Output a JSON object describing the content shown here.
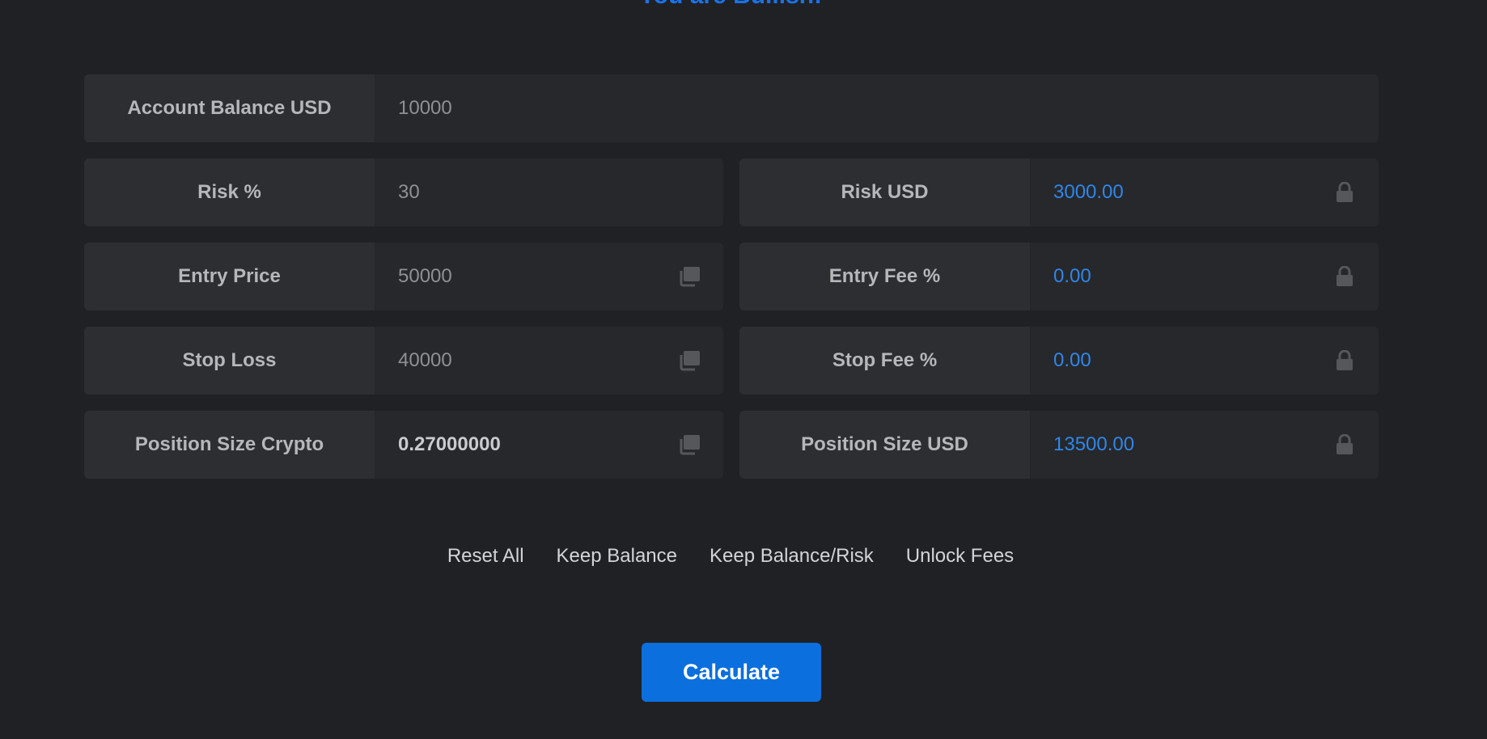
{
  "header": {
    "title": "You are Bullish!"
  },
  "fields": {
    "account_balance": {
      "label": "Account Balance USD",
      "value": "10000"
    },
    "risk_pct": {
      "label": "Risk %",
      "value": "30"
    },
    "risk_usd": {
      "label": "Risk USD",
      "value": "3000.00"
    },
    "entry_price": {
      "label": "Entry Price",
      "value": "50000"
    },
    "entry_fee": {
      "label": "Entry Fee %",
      "value": "0.00"
    },
    "stop_loss": {
      "label": "Stop Loss",
      "value": "40000"
    },
    "stop_fee": {
      "label": "Stop Fee %",
      "value": "0.00"
    },
    "position_crypto": {
      "label": "Position Size Crypto",
      "value": "0.27000000"
    },
    "position_usd": {
      "label": "Position Size USD",
      "value": "13500.00"
    }
  },
  "actions": {
    "reset_all": "Reset All",
    "keep_balance": "Keep Balance",
    "keep_balance_risk": "Keep Balance/Risk",
    "unlock_fees": "Unlock Fees"
  },
  "calculate_label": "Calculate",
  "icons": {
    "copy": "copy-icon",
    "lock": "lock-icon"
  },
  "colors": {
    "accent": "#0b6fde",
    "value_blue": "#2f86e8",
    "background": "#202124"
  }
}
